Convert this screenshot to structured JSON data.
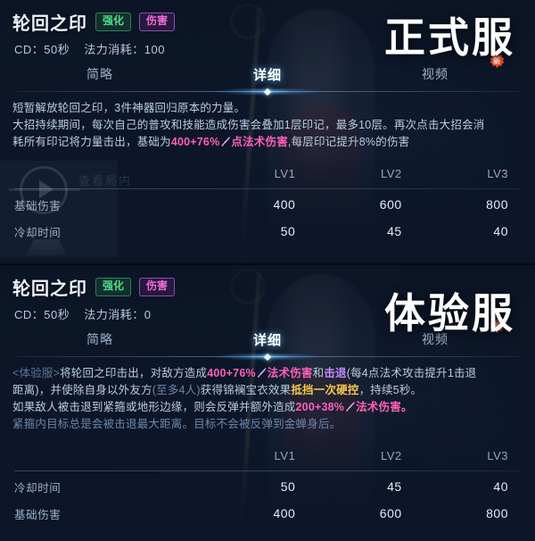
{
  "panels": [
    {
      "server_watermark": "正式服",
      "skill_name": "轮回之印",
      "tags": [
        {
          "label": "强化",
          "kind": "buff"
        },
        {
          "label": "伤害",
          "kind": "damage"
        }
      ],
      "meta": {
        "cooldown": "CD：50秒",
        "mana": "法力消耗：100"
      },
      "tabs": [
        {
          "label": "简略",
          "active": false,
          "badge": ""
        },
        {
          "label": "详细",
          "active": true,
          "badge": ""
        },
        {
          "label": "视频",
          "active": false,
          "badge": "新"
        }
      ],
      "description_lines": [
        [
          {
            "t": "短暂解放轮回之印，3件神器回归原本的力量。",
            "c": "normal"
          }
        ],
        [
          {
            "t": "大招持续期间，每次自己的普攻和技能造成伤害会叠加1层印记，最多10层。再次点击大招会消",
            "c": "normal"
          }
        ],
        [
          {
            "t": "耗所有印记将力量击出，基础为",
            "c": "normal"
          },
          {
            "t": "400+76%",
            "c": "pink"
          },
          {
            "t": "sword-icon",
            "c": "icon"
          },
          {
            "t": "点法术伤害",
            "c": "pink"
          },
          {
            "t": ",每层印记提升8%的伤害",
            "c": "normal"
          }
        ]
      ],
      "ghost_text": "查看局内",
      "table": {
        "level_headers": [
          "LV1",
          "LV2",
          "LV3"
        ],
        "rows": [
          {
            "label": "基础伤害",
            "values": [
              "400",
              "600",
              "800"
            ]
          },
          {
            "label": "冷却时间",
            "values": [
              "50",
              "45",
              "40"
            ]
          }
        ]
      }
    },
    {
      "server_watermark": "体验服",
      "skill_name": "轮回之印",
      "tags": [
        {
          "label": "强化",
          "kind": "buff"
        },
        {
          "label": "伤害",
          "kind": "damage"
        }
      ],
      "meta": {
        "cooldown": "CD：50秒",
        "mana": "法力消耗：0"
      },
      "tabs": [
        {
          "label": "简略",
          "active": false,
          "badge": ""
        },
        {
          "label": "详细",
          "active": true,
          "badge": ""
        },
        {
          "label": "视频",
          "active": false,
          "badge": "新"
        }
      ],
      "description_lines": [
        [
          {
            "t": "<体验服>",
            "c": "faded"
          },
          {
            "t": "将轮回之印击出，对敌方造成",
            "c": "normal"
          },
          {
            "t": "400+76%",
            "c": "pink"
          },
          {
            "t": "sword-icon",
            "c": "icon"
          },
          {
            "t": "法术伤害",
            "c": "pink"
          },
          {
            "t": "和",
            "c": "normal"
          },
          {
            "t": "击退",
            "c": "violet"
          },
          {
            "t": "(每4点法术攻击提升1击退",
            "c": "normal"
          }
        ],
        [
          {
            "t": "距离)，并使除自身以外友方",
            "c": "normal"
          },
          {
            "t": "(至多4人)",
            "c": "dim"
          },
          {
            "t": "获得锦襕宝衣效果",
            "c": "normal"
          },
          {
            "t": "抵挡一次硬控",
            "c": "yellow"
          },
          {
            "t": "，持续5秒。",
            "c": "normal"
          }
        ],
        [
          {
            "t": "如果敌人被击退到紧箍或地形边缘，则会反弹并额外造成",
            "c": "normal"
          },
          {
            "t": "200+38%",
            "c": "pink"
          },
          {
            "t": "sword-icon",
            "c": "icon"
          },
          {
            "t": "法术伤害。",
            "c": "pink"
          }
        ],
        [
          {
            "t": "紧箍内目标总是会被击退最大距离。目标不会被反弹到金蝉身后。",
            "c": "dim"
          }
        ]
      ],
      "ghost_text": "",
      "table": {
        "level_headers": [
          "LV1",
          "LV2",
          "LV3"
        ],
        "rows": [
          {
            "label": "冷却时间",
            "values": [
              "50",
              "45",
              "40"
            ]
          },
          {
            "label": "基础伤害",
            "values": [
              "400",
              "600",
              "800"
            ]
          }
        ]
      }
    }
  ],
  "colors": {
    "background": "#0c1626",
    "accent_blue": "#6ebeff",
    "tag_buff": "#4ce08a",
    "tag_damage": "#f06ad6",
    "keyword_pink": "#ff5fb8",
    "keyword_violet": "#c08bff",
    "keyword_yellow": "#f5c64a",
    "badge_new": "#e33b22"
  }
}
